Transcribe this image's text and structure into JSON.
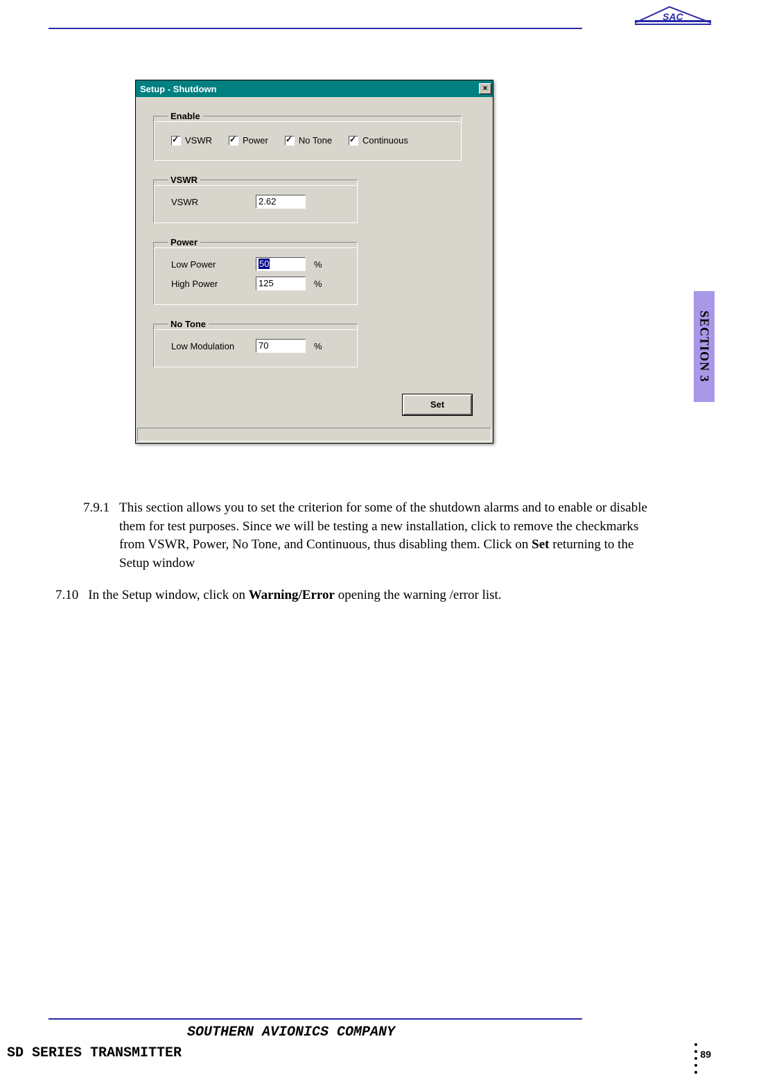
{
  "logo_name": "sac-logo",
  "section_tab": "SECTION 3",
  "dialog": {
    "title": "Setup - Shutdown",
    "close_glyph": "×",
    "enable": {
      "legend": "Enable",
      "items": [
        {
          "label": "VSWR",
          "checked": true
        },
        {
          "label": "Power",
          "checked": true
        },
        {
          "label": "No Tone",
          "checked": true
        },
        {
          "label": "Continuous",
          "checked": true
        }
      ]
    },
    "vswr": {
      "legend": "VSWR",
      "label": "VSWR",
      "value": "2.62"
    },
    "power": {
      "legend": "Power",
      "low_label": "Low Power",
      "low_value": "50",
      "low_highlighted": true,
      "high_label": "High Power",
      "high_value": "125",
      "unit": "%"
    },
    "notone": {
      "legend": "No Tone",
      "label": "Low Modulation",
      "value": "70",
      "unit": "%"
    },
    "set_button": "Set"
  },
  "paragraphs": {
    "p791_num": "7.9.1",
    "p791_text_pre": "This section allows you to set the criterion for some of the shutdown alarms and to enable or disable them for test purposes. Since we will be testing a new installation, click to remove the checkmarks from VSWR, Power, No Tone, and Continuous, thus disabling them. Click on ",
    "p791_bold": "Set",
    "p791_text_post": " returning to the Setup window",
    "p710_num": "7.10",
    "p710_text_pre": "In the Setup window, click on ",
    "p710_bold": "Warning/Error",
    "p710_text_post": " opening the warning /error list."
  },
  "footer": {
    "company": "SOUTHERN AVIONICS COMPANY",
    "product": "SD SERIES TRANSMITTER",
    "page": "89"
  }
}
